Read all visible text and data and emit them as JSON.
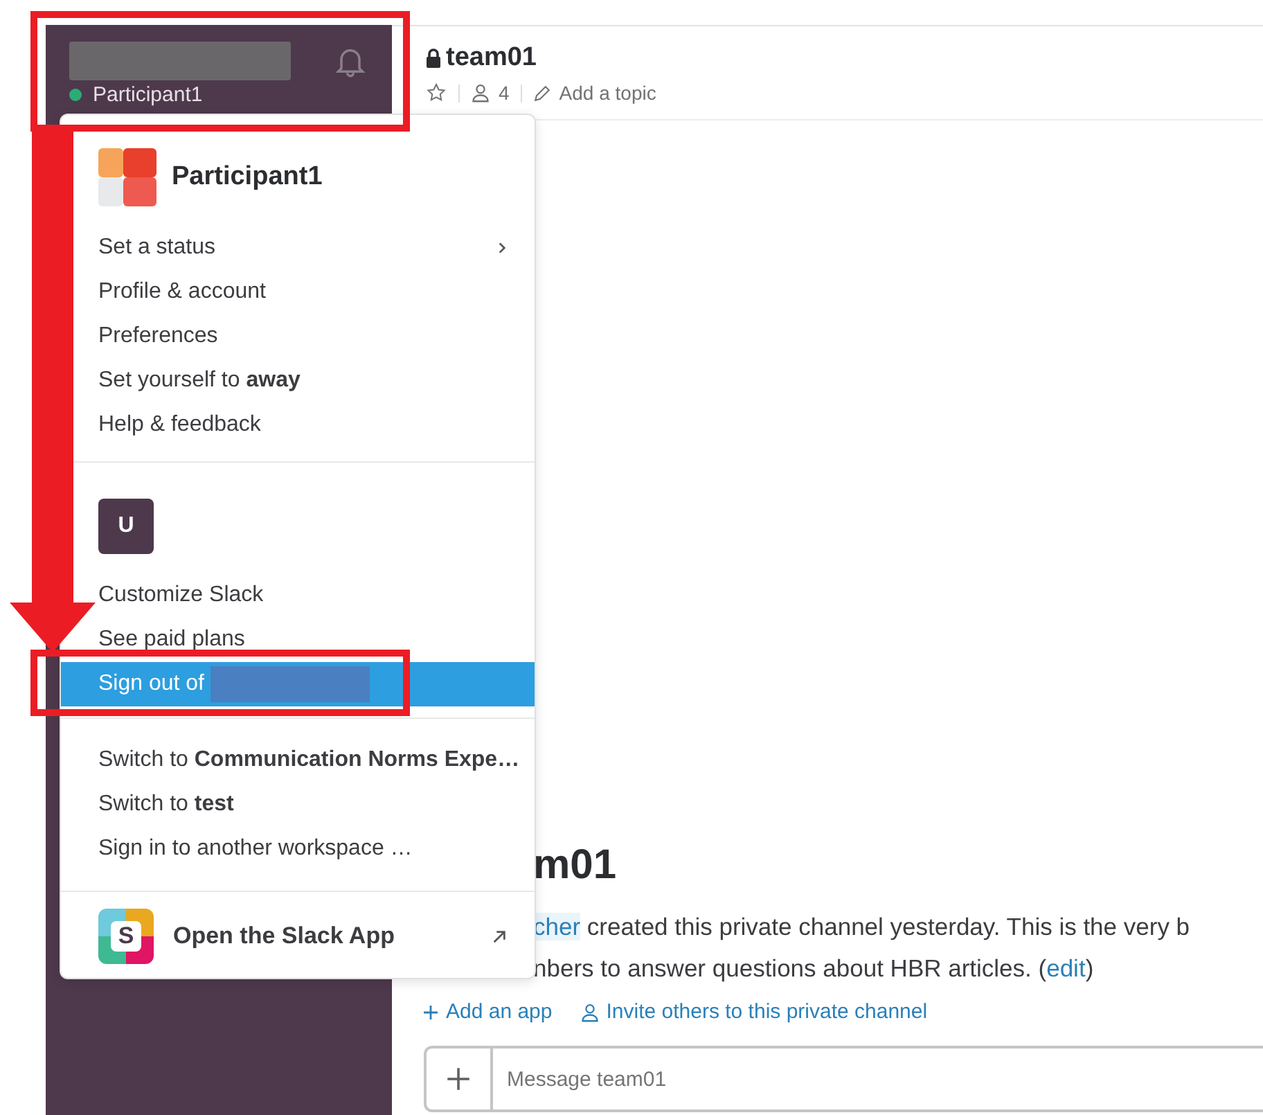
{
  "sidebar": {
    "user": "Participant1",
    "online": true
  },
  "channel": {
    "name": "team01",
    "starred": false,
    "members": "4",
    "topic": "Add a topic"
  },
  "menu": {
    "profile": {
      "name": "Participant1"
    },
    "account_items": [
      {
        "label": "Set a status",
        "submenu": true,
        "selected": false
      },
      {
        "label": "Profile & account",
        "submenu": false,
        "selected": false
      },
      {
        "label": "Preferences",
        "submenu": false,
        "selected": false
      },
      {
        "label": "Set yourself to **away**",
        "submenu": false,
        "selected": false
      },
      {
        "label": "Help & feedback",
        "submenu": false,
        "selected": false
      }
    ],
    "workspace": {
      "initial": "U"
    },
    "workspace_items": [
      {
        "label": "Customize Slack",
        "redacted": false,
        "selected": false
      },
      {
        "label": "See paid plans",
        "redacted": false,
        "selected": false
      },
      {
        "label": "Sign out of",
        "redacted": true,
        "selected": true
      }
    ],
    "switch_items": [
      {
        "label": "Switch to **Communication Norms Expe…**",
        "selected": false
      },
      {
        "label": "Switch to **test**",
        "selected": false
      },
      {
        "label": "Sign in to another workspace …",
        "selected": false
      }
    ],
    "footer": {
      "logo_letter": "S",
      "label": "Open the Slack App"
    }
  },
  "intro": {
    "heading": "m01",
    "mention": "cher",
    "line1": "created this private channel yesterday. This is the very b",
    "line2": "nbers to answer questions about HBR articles. (",
    "link": "edit",
    "line2_end": ")"
  },
  "actions": [
    {
      "kind": "add",
      "label": "Add an app"
    },
    {
      "kind": "invite",
      "label": "Invite others to this private channel"
    }
  ],
  "composer": {
    "placeholder": "Message team01"
  },
  "annotations": [
    {
      "kind": "frame"
    },
    {
      "kind": "arrow"
    },
    {
      "kind": "frame"
    }
  ]
}
